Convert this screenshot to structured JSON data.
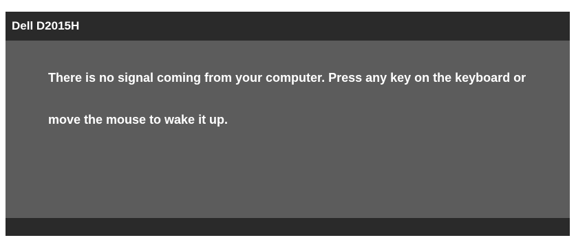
{
  "header": {
    "title": "Dell D2015H"
  },
  "body": {
    "message": "There is no signal coming from your computer. Press any key on the keyboard or move the mouse to wake it up."
  },
  "colors": {
    "header_bg": "#2a2a2a",
    "body_bg": "#5c5c5c",
    "text": "#ffffff"
  }
}
